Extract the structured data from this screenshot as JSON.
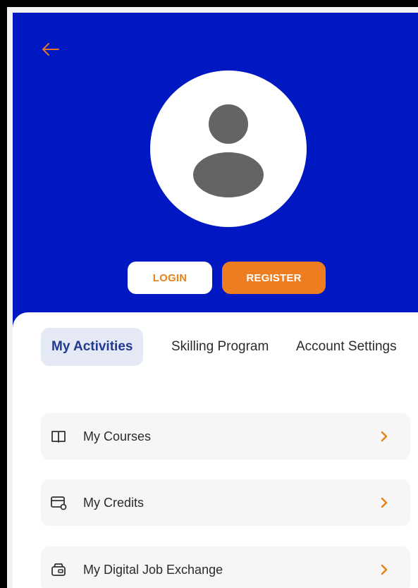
{
  "auth": {
    "login_label": "LOGIN",
    "register_label": "REGISTER"
  },
  "tabs": [
    {
      "label": "My Activities",
      "active": true
    },
    {
      "label": "Skilling Program",
      "active": false
    },
    {
      "label": "Account Settings",
      "active": false
    }
  ],
  "menu": [
    {
      "label": "My Courses",
      "icon": "book-icon"
    },
    {
      "label": "My Credits",
      "icon": "credit-card-icon"
    },
    {
      "label": "My Digital Job Exchange",
      "icon": "wallet-icon"
    }
  ],
  "colors": {
    "header_bg": "#0018c2",
    "accent_orange": "#ee7d22",
    "active_tab_bg": "#e5e9f6",
    "active_tab_text": "#1f3a8f"
  }
}
